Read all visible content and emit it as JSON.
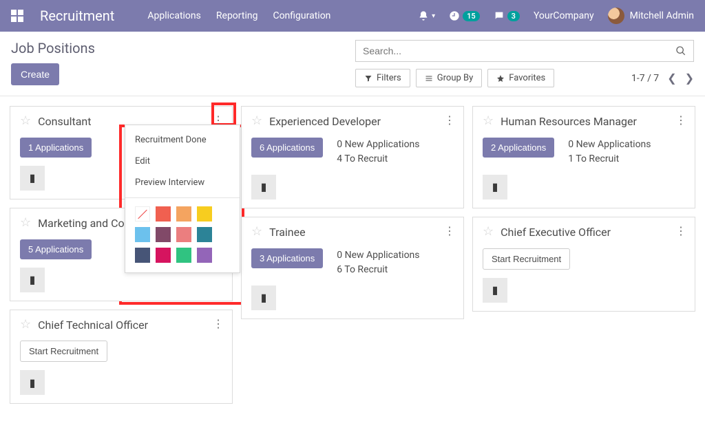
{
  "module": "Recruitment",
  "nav": {
    "applications": "Applications",
    "reporting": "Reporting",
    "configuration": "Configuration"
  },
  "topbar": {
    "activity_count": "15",
    "chat_count": "3",
    "company": "YourCompany",
    "user": "Mitchell Admin"
  },
  "page": {
    "title": "Job Positions",
    "create": "Create"
  },
  "search": {
    "placeholder": "Search...",
    "filters": "Filters",
    "group_by": "Group By",
    "favorites": "Favorites",
    "pager": "1-7 / 7"
  },
  "menu": {
    "done": "Recruitment Done",
    "edit": "Edit",
    "preview": "Preview Interview"
  },
  "colors": [
    "none",
    "#f06050",
    "#f4a460",
    "#f7cd1f",
    "#6cc1ed",
    "#814968",
    "#eb7e7f",
    "#2c8397",
    "#475577",
    "#d6145f",
    "#30c381",
    "#9365b8"
  ],
  "cards": [
    {
      "title": "Consultant",
      "apps": "1 Applications",
      "show_meta": false
    },
    {
      "title": "Experienced Developer",
      "apps": "6 Applications",
      "show_meta": true,
      "new": "0 New Applications",
      "recruit": "4 To Recruit"
    },
    {
      "title": "Human Resources Manager",
      "apps": "2 Applications",
      "show_meta": true,
      "new": "0 New Applications",
      "recruit": "1 To Recruit"
    },
    {
      "title": "Marketing and Community Manager",
      "apps": "5 Applications",
      "show_meta": false
    },
    {
      "title": "Trainee",
      "apps": "3 Applications",
      "show_meta": true,
      "new": "0 New Applications",
      "recruit": "6 To Recruit"
    },
    {
      "title": "Chief Executive Officer",
      "start": "Start Recruitment"
    },
    {
      "title": "Chief Technical Officer",
      "start": "Start Recruitment"
    }
  ]
}
